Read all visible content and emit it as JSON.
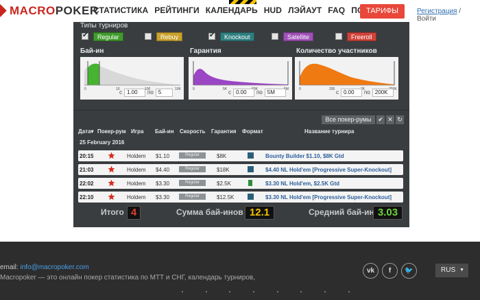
{
  "header": {
    "logo_a": "MACRO",
    "logo_b": "POKER",
    "nav": [
      "СТАТИСТИКА",
      "РЕЙТИНГИ",
      "КАЛЕНДАРЬ",
      "HUD",
      "ЛЭЙАУТ",
      "FAQ",
      "ПОДДЕРЖКА"
    ],
    "tariff_label": "ТАРИФЫ",
    "register_label": "Регистрация",
    "separator": " / ",
    "login_label": "Войти"
  },
  "filters": {
    "types_title": "Типы турниров",
    "types": [
      {
        "label": "Regular",
        "checked": true,
        "color": "#3f9b2c"
      },
      {
        "label": "Rebuy",
        "checked": false,
        "color": "#c9a12b"
      },
      {
        "label": "Knockout",
        "checked": true,
        "color": "#2f7f80"
      },
      {
        "label": "Satellite",
        "checked": false,
        "color": "#a050b8"
      },
      {
        "label": "Freeroll",
        "checked": false,
        "color": "#d0433a"
      }
    ],
    "buyin": {
      "title": "Бай-ин",
      "ticks": [
        "0",
        "10",
        "100",
        "10K"
      ],
      "from_label": "с",
      "to_label": "по",
      "from": "1.00",
      "to": "5",
      "color": "#46b430"
    },
    "guarantee": {
      "title": "Гарантия",
      "ticks": [
        "0",
        "5K",
        "50K",
        "5M"
      ],
      "from_label": "с",
      "to_label": "по",
      "from": "0.00",
      "to": "5M",
      "color": "#9b46c4"
    },
    "participants": {
      "title": "Количество участников",
      "ticks": [
        "0",
        "200",
        "2K",
        "200K"
      ],
      "from_label": "с",
      "to_label": "по",
      "from": "0.00",
      "to": "200K",
      "color": "#f07a12"
    }
  },
  "table": {
    "all_rooms": "Все покер-румы",
    "check_icon": "✔",
    "close_icon": "✕",
    "refresh_icon": "↻",
    "columns": [
      "Дата▾",
      "Покер-рум",
      "Игра",
      "Бай-ин",
      "Скорость",
      "Гарантия",
      "Формат",
      "Название турнира"
    ],
    "date": "25 February 2016",
    "rows": [
      {
        "time": "20:15",
        "game": "Holdem",
        "buyin": "$1.10",
        "speed": "Regular",
        "guarantee": "$8K",
        "format": "blue",
        "name": "Bounty Builder $1.10, $8K Gtd"
      },
      {
        "time": "21:03",
        "game": "Holdem",
        "buyin": "$4.40",
        "speed": "Regular",
        "guarantee": "$18K",
        "format": "blue",
        "name": "$4.40 NL Hold'em [Progressive Super-Knockout]"
      },
      {
        "time": "22:02",
        "game": "Holdem",
        "buyin": "$3.30",
        "speed": "Regular",
        "guarantee": "$2.5K",
        "format": "green",
        "name": "$3.30 NL Hold'em, $2.5K Gtd"
      },
      {
        "time": "22:10",
        "game": "Holdem",
        "buyin": "$3.30",
        "speed": "Regular",
        "guarantee": "$12.5K",
        "format": "blue",
        "name": "$3.30 NL Hold'em [Progressive Super-Knockout]"
      }
    ]
  },
  "summary": {
    "total_label": "Итого",
    "total": "4",
    "sum_label": "Сумма бай-инов",
    "sum": "12.1",
    "avg_label": "Средний бай-ин",
    "avg": "3.03"
  },
  "footer": {
    "email_label": "email:",
    "email": "info@macropoker.com",
    "description": "Macropoker — это онлайн покер статистика по МТТ и СНГ, календарь турниров,",
    "social": [
      "vk",
      "f",
      "🐦"
    ],
    "language": "RUS"
  }
}
